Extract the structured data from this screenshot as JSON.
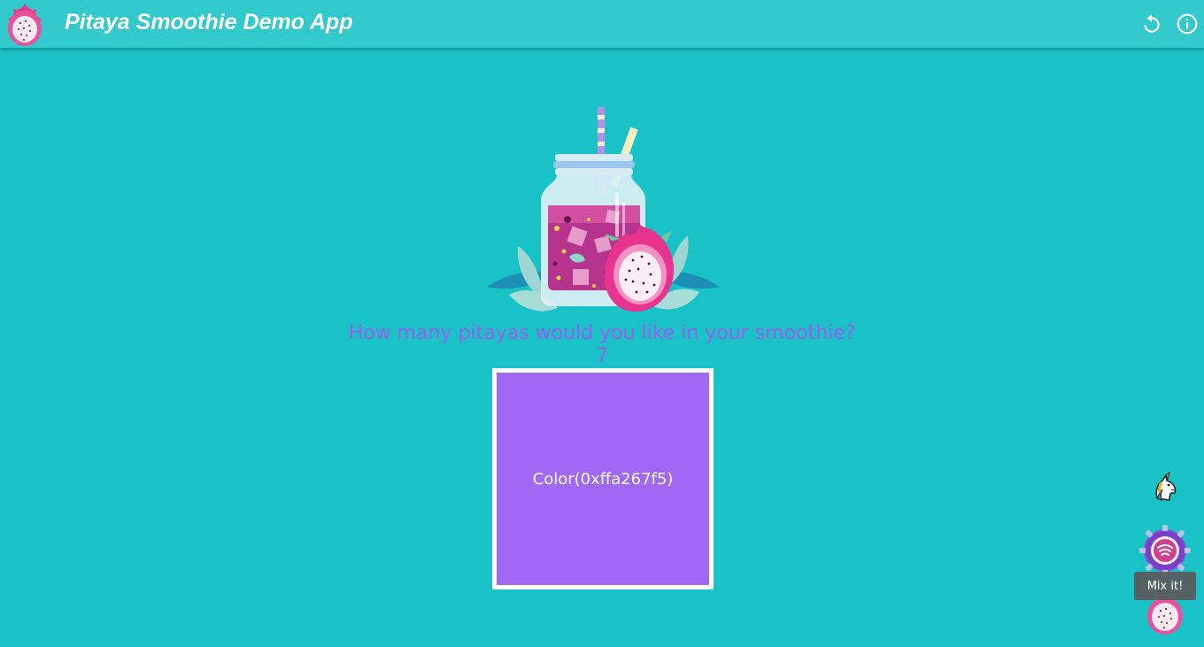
{
  "app_bar": {
    "title": "Pitaya Smoothie Demo App",
    "logo_icon": "pitaya-logo-icon",
    "actions": [
      {
        "name": "reload",
        "icon": "reload-icon"
      },
      {
        "name": "info",
        "icon": "info-icon"
      }
    ]
  },
  "main": {
    "question": "How many pitayas would you like in your smoothie?",
    "count": "7",
    "color_card": {
      "label": "Color(0xffa267f5)",
      "color": "#a267f5"
    }
  },
  "fab": {
    "unicorn_icon": "unicorn-icon",
    "mix_icon": "mix-gear-icon",
    "mix_tooltip": "Mix it!",
    "pitaya_icon": "pitaya-icon"
  },
  "colors": {
    "background": "#19c2c6",
    "app_bar": "#31c9cb",
    "accent": "#9c5cf0"
  }
}
